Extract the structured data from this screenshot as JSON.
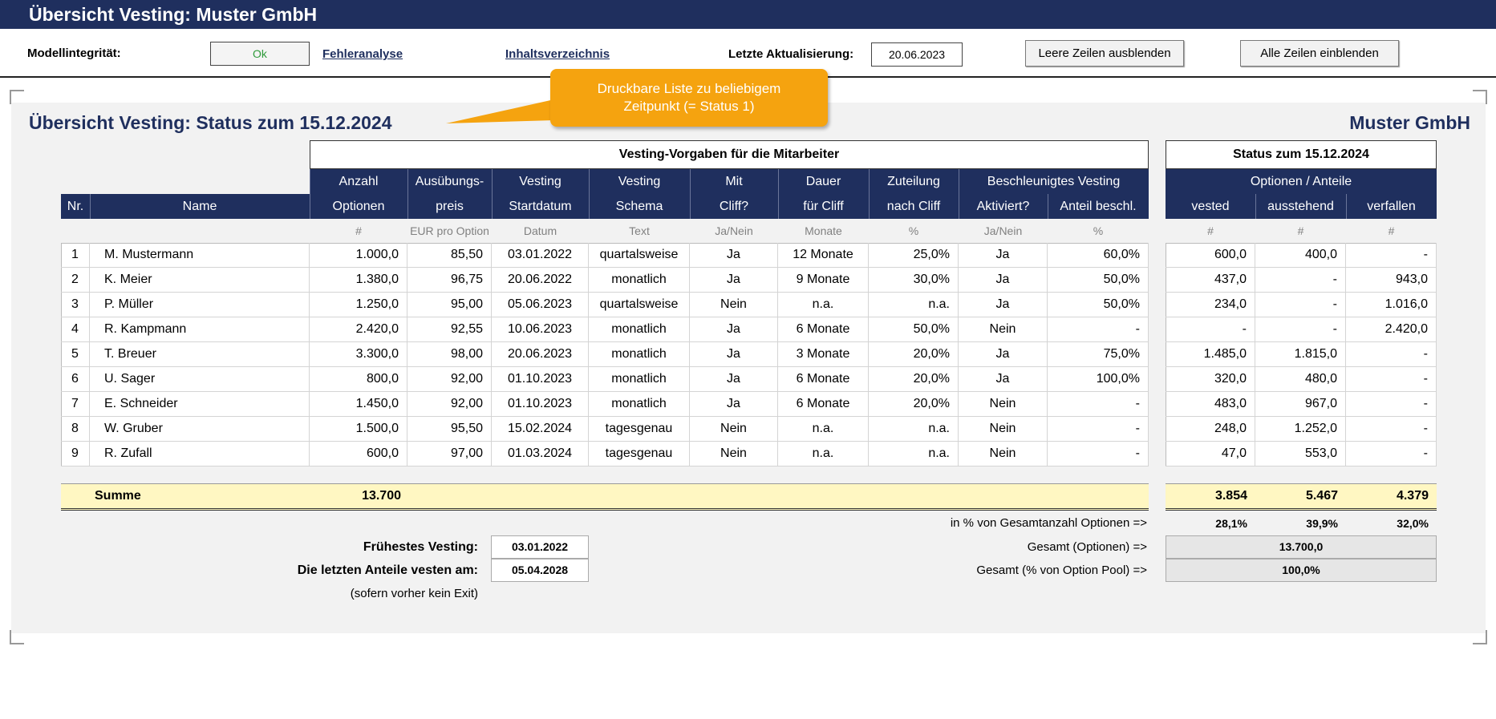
{
  "header": {
    "title": "Übersicht Vesting: Muster GmbH"
  },
  "toolbar": {
    "model_integrity_label": "Modellintegrität:",
    "model_integrity_value": "Ok",
    "error_analysis_link": "Fehleranalyse",
    "toc_link": "Inhaltsverzeichnis",
    "last_update_label": "Letzte Aktualisierung:",
    "last_update_value": "20.06.2023",
    "hide_empty_rows_button": "Leere Zeilen ausblenden",
    "show_all_rows_button": "Alle Zeilen einblenden"
  },
  "callout": {
    "line1": "Druckbare Liste zu beliebigem",
    "line2": "Zeitpunkt (= Status 1)"
  },
  "report": {
    "title": "Übersicht Vesting: Status zum 15.12.2024",
    "company": "Muster GmbH",
    "group_left": "Vesting-Vorgaben für die Mitarbeiter",
    "group_right": "Status zum 15.12.2024",
    "subgroup_right": "Optionen / Anteile",
    "col_nr": "Nr.",
    "col_name": "Name",
    "cols_top": [
      "Anzahl",
      "Ausübungs-",
      "Vesting",
      "Vesting",
      "Mit",
      "Dauer",
      "Zuteilung",
      "Beschleunigtes Vesting"
    ],
    "cols_bottom": [
      "Optionen",
      "preis",
      "Startdatum",
      "Schema",
      "Cliff?",
      "für Cliff",
      "nach Cliff",
      "Aktiviert?",
      "Anteil beschl."
    ],
    "cols_right": [
      "vested",
      "ausstehend",
      "verfallen"
    ],
    "units": [
      "#",
      "EUR pro Option",
      "Datum",
      "Text",
      "Ja/Nein",
      "Monate",
      "%",
      "Ja/Nein",
      "%",
      "#",
      "#",
      "#"
    ],
    "rows": [
      [
        "1",
        "M. Mustermann",
        "1.000,0",
        "85,50",
        "03.01.2022",
        "quartalsweise",
        "Ja",
        "12 Monate",
        "25,0%",
        "Ja",
        "60,0%",
        "600,0",
        "400,0",
        "-"
      ],
      [
        "2",
        "K. Meier",
        "1.380,0",
        "96,75",
        "20.06.2022",
        "monatlich",
        "Ja",
        "9 Monate",
        "30,0%",
        "Ja",
        "50,0%",
        "437,0",
        "-",
        "943,0"
      ],
      [
        "3",
        "P. Müller",
        "1.250,0",
        "95,00",
        "05.06.2023",
        "quartalsweise",
        "Nein",
        "n.a.",
        "n.a.",
        "Ja",
        "50,0%",
        "234,0",
        "-",
        "1.016,0"
      ],
      [
        "4",
        "R. Kampmann",
        "2.420,0",
        "92,55",
        "10.06.2023",
        "monatlich",
        "Ja",
        "6 Monate",
        "50,0%",
        "Nein",
        "-",
        "-",
        "-",
        "2.420,0"
      ],
      [
        "5",
        "T. Breuer",
        "3.300,0",
        "98,00",
        "20.06.2023",
        "monatlich",
        "Ja",
        "3 Monate",
        "20,0%",
        "Ja",
        "75,0%",
        "1.485,0",
        "1.815,0",
        "-"
      ],
      [
        "6",
        "U. Sager",
        "800,0",
        "92,00",
        "01.10.2023",
        "monatlich",
        "Ja",
        "6 Monate",
        "20,0%",
        "Ja",
        "100,0%",
        "320,0",
        "480,0",
        "-"
      ],
      [
        "7",
        "E. Schneider",
        "1.450,0",
        "92,00",
        "01.10.2023",
        "monatlich",
        "Ja",
        "6 Monate",
        "20,0%",
        "Nein",
        "-",
        "483,0",
        "967,0",
        "-"
      ],
      [
        "8",
        "W. Gruber",
        "1.500,0",
        "95,50",
        "15.02.2024",
        "tagesgenau",
        "Nein",
        "n.a.",
        "n.a.",
        "Nein",
        "-",
        "248,0",
        "1.252,0",
        "-"
      ],
      [
        "9",
        "R. Zufall",
        "600,0",
        "97,00",
        "01.03.2024",
        "tagesgenau",
        "Nein",
        "n.a.",
        "n.a.",
        "Nein",
        "-",
        "47,0",
        "553,0",
        "-"
      ]
    ],
    "sum": {
      "label": "Summe",
      "options": "13.700",
      "vested": "3.854",
      "outstanding": "5.467",
      "forfeited": "4.379"
    },
    "pct_label": "in % von Gesamtanzahl Optionen =>",
    "pct": {
      "vested": "28,1%",
      "outstanding": "39,9%",
      "forfeited": "32,0%"
    },
    "earliest_label": "Frühestes Vesting:",
    "earliest_value": "03.01.2022",
    "last_label": "Die letzten Anteile vesten am:",
    "last_value": "05.04.2028",
    "no_exit_note": "(sofern vorher kein Exit)",
    "total_options_label": "Gesamt (Optionen) =>",
    "total_options_value": "13.700,0",
    "total_pool_label": "Gesamt (% von Option Pool) =>",
    "total_pool_value": "100,0%"
  },
  "colors": {
    "navy": "#1f2f5e",
    "callout": "#f5a30f",
    "sum_band": "#fff7c2",
    "ok_green": "#2e9a3a"
  }
}
